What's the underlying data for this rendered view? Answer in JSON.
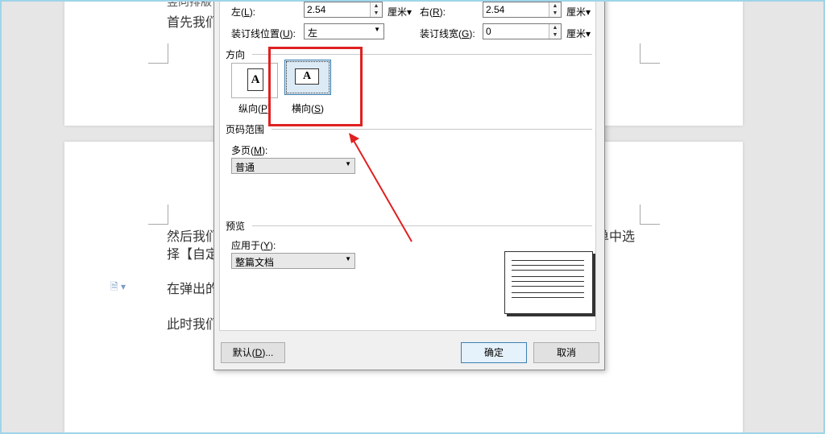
{
  "document": {
    "line_top_partial": "竖向排版",
    "line1": "首先我们",
    "line2_left": "然后我们",
    "line2_right": "单中选",
    "line3": "择【自定",
    "line4": "在弹出的",
    "line5": "此时我们"
  },
  "dialog": {
    "margins": {
      "left_label": "左(",
      "left_key": "L",
      "left_value": "2.54",
      "right_label": "右(",
      "right_key": "R",
      "right_value": "2.54",
      "unit": "厘米",
      "gutter_pos_label": "装订线位置(",
      "gutter_pos_key": "U",
      "gutter_pos_value": "左",
      "gutter_width_label": "装订线宽(",
      "gutter_width_key": "G",
      "gutter_width_value": "0"
    },
    "orientation": {
      "section": "方向",
      "portrait_label": "纵向(",
      "portrait_key": "P",
      "landscape_label": "横向(",
      "landscape_key": "S",
      "glyph": "A"
    },
    "pages": {
      "section": "页码范围",
      "multi_label": "多页(",
      "multi_key": "M",
      "multi_value": "普通"
    },
    "preview": {
      "section": "预览",
      "apply_label": "应用于(",
      "apply_key": "Y",
      "apply_value": "整篇文档"
    },
    "buttons": {
      "default_label": "默认(",
      "default_key": "D",
      "default_suffix": ")...",
      "ok": "确定",
      "cancel": "取消"
    }
  },
  "colors": {
    "highlight": "#e02020",
    "accent": "#3c7fb1"
  },
  "icons": {
    "doc": "document-icon"
  }
}
